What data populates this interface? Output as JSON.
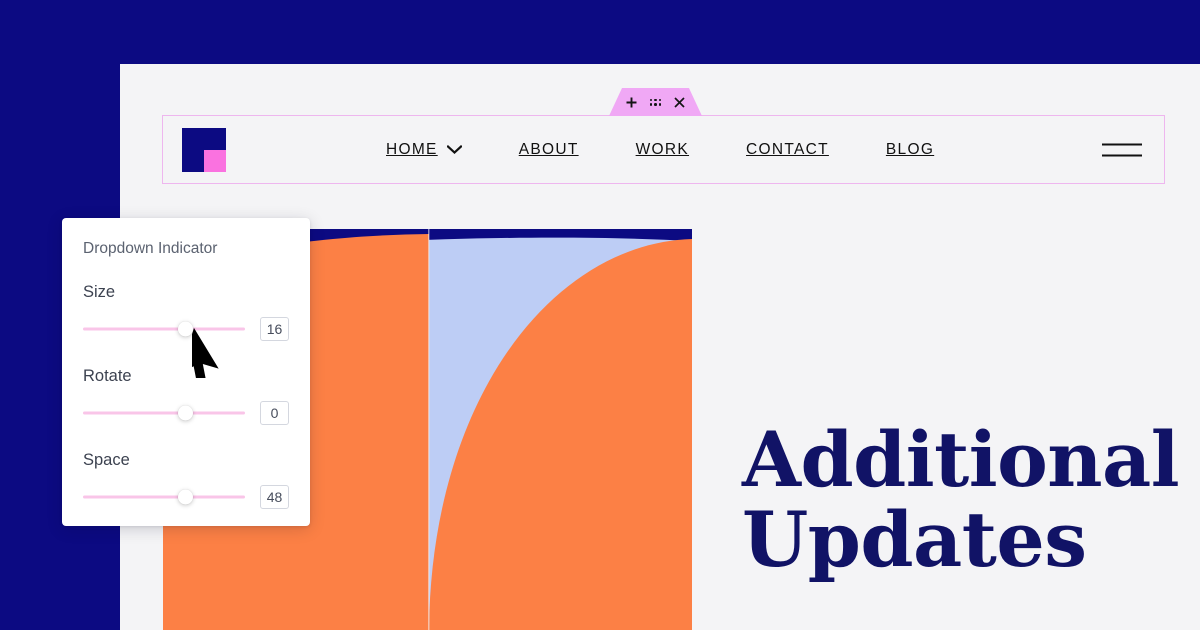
{
  "theme": {
    "navy": "#0c0a82",
    "canvas_bg": "#f4f4f6",
    "accent_pink": "#f0a8f5",
    "slider_track": "#f9c5e8",
    "orange": "#fc8045",
    "periwinkle": "#bdcdf5",
    "heading_navy": "#111366",
    "logo_pink": "#fa72e0"
  },
  "toolbar": {
    "add_label": "+",
    "drag_label": "drag-handle",
    "close_label": "✕"
  },
  "navbar": {
    "logo_name": "site-logo",
    "links": [
      {
        "label": "HOME",
        "has_dropdown": true
      },
      {
        "label": "ABOUT",
        "has_dropdown": false
      },
      {
        "label": "WORK",
        "has_dropdown": false
      },
      {
        "label": "CONTACT",
        "has_dropdown": false
      },
      {
        "label": "BLOG",
        "has_dropdown": false
      }
    ],
    "menu_label": "menu"
  },
  "hero": {
    "heading": "Additional\nUpdates"
  },
  "panel": {
    "title": "Dropdown Indicator",
    "controls": [
      {
        "label": "Size",
        "value": "16",
        "thumb_pct": 63
      },
      {
        "label": "Rotate",
        "value": "0",
        "thumb_pct": 63
      },
      {
        "label": "Space",
        "value": "48",
        "thumb_pct": 63
      }
    ]
  },
  "cursor": {
    "name": "mouse-pointer"
  }
}
